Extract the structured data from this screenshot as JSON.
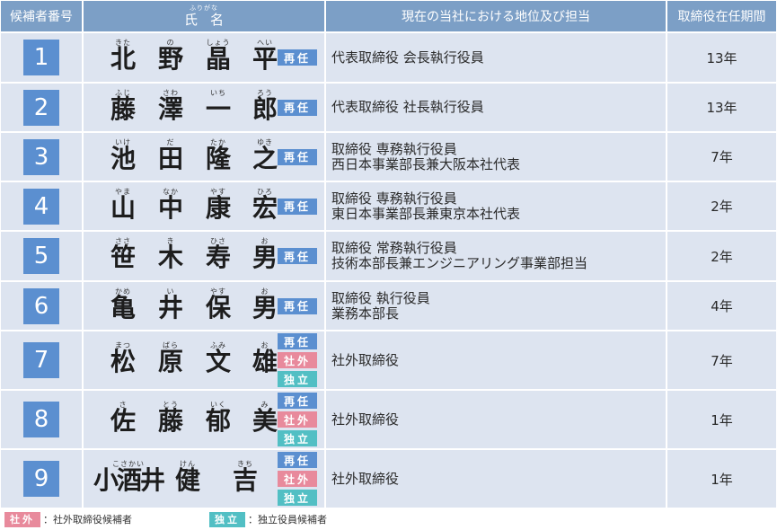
{
  "header": {
    "num": "候補者番号",
    "name_ruby": "ふりがな",
    "name": "氏名",
    "position": "現在の当社における地位及び担当",
    "years": "取締役在任期間"
  },
  "badge_labels": {
    "reappoint": "再任",
    "outside": "社外",
    "independent": "独立"
  },
  "candidates": [
    {
      "num": "1",
      "kanji": [
        "北",
        "野",
        "晶",
        "平"
      ],
      "kana": [
        "きた",
        "の",
        "しょう",
        "へい"
      ],
      "badges": [
        "reappoint"
      ],
      "position": [
        "代表取締役 会長執行役員"
      ],
      "years": "13年"
    },
    {
      "num": "2",
      "kanji": [
        "藤",
        "澤",
        "一",
        "郎"
      ],
      "kana": [
        "ふじ",
        "さわ",
        "いち",
        "ろう"
      ],
      "badges": [
        "reappoint"
      ],
      "position": [
        "代表取締役 社長執行役員"
      ],
      "years": "13年"
    },
    {
      "num": "3",
      "kanji": [
        "池",
        "田",
        "隆",
        "之"
      ],
      "kana": [
        "いけ",
        "だ",
        "たか",
        "ゆき"
      ],
      "badges": [
        "reappoint"
      ],
      "position": [
        "取締役 専務執行役員",
        "西日本事業部長兼大阪本社代表"
      ],
      "years": "7年"
    },
    {
      "num": "4",
      "kanji": [
        "山",
        "中",
        "康",
        "宏"
      ],
      "kana": [
        "やま",
        "なか",
        "やす",
        "ひろ"
      ],
      "badges": [
        "reappoint"
      ],
      "position": [
        "取締役 専務執行役員",
        "東日本事業部長兼東京本社代表"
      ],
      "years": "2年"
    },
    {
      "num": "5",
      "kanji": [
        "笹",
        "木",
        "寿",
        "男"
      ],
      "kana": [
        "ささ",
        "き",
        "ひさ",
        "お"
      ],
      "badges": [
        "reappoint"
      ],
      "position": [
        "取締役 常務執行役員",
        "技術本部長兼エンジニアリング事業部担当"
      ],
      "years": "2年"
    },
    {
      "num": "6",
      "kanji": [
        "亀",
        "井",
        "保",
        "男"
      ],
      "kana": [
        "かめ",
        "い",
        "やす",
        "お"
      ],
      "badges": [
        "reappoint"
      ],
      "position": [
        "取締役 執行役員",
        "業務本部長"
      ],
      "years": "4年"
    },
    {
      "num": "7",
      "kanji": [
        "松",
        "原",
        "文",
        "雄"
      ],
      "kana": [
        "まつ",
        "ばら",
        "ふみ",
        "お"
      ],
      "badges": [
        "reappoint",
        "outside",
        "independent"
      ],
      "position": [
        "社外取締役"
      ],
      "years": "7年"
    },
    {
      "num": "8",
      "kanji": [
        "佐",
        "藤",
        "郁",
        "美"
      ],
      "kana": [
        "さ",
        "とう",
        "いく",
        "み"
      ],
      "badges": [
        "reappoint",
        "outside",
        "independent"
      ],
      "position": [
        "社外取締役"
      ],
      "years": "1年"
    },
    {
      "num": "9",
      "kanji": [
        "小酒井",
        "健",
        "吉"
      ],
      "kana": [
        "こさかい",
        "けん",
        "きち"
      ],
      "badges": [
        "reappoint",
        "outside",
        "independent"
      ],
      "position": [
        "社外取締役"
      ],
      "years": "1年"
    }
  ],
  "legend": {
    "outside_badge": "社外",
    "outside_text": "：社外取締役候補者",
    "independent_badge": "独立",
    "independent_text": "：独立役員候補者"
  },
  "colors": {
    "header": "#7c9fc6",
    "shade": "#dde4f0",
    "number": "#5b8fd0",
    "reappoint": "#5b8fd0",
    "outside": "#e88a9c",
    "independent": "#52bfc4"
  }
}
